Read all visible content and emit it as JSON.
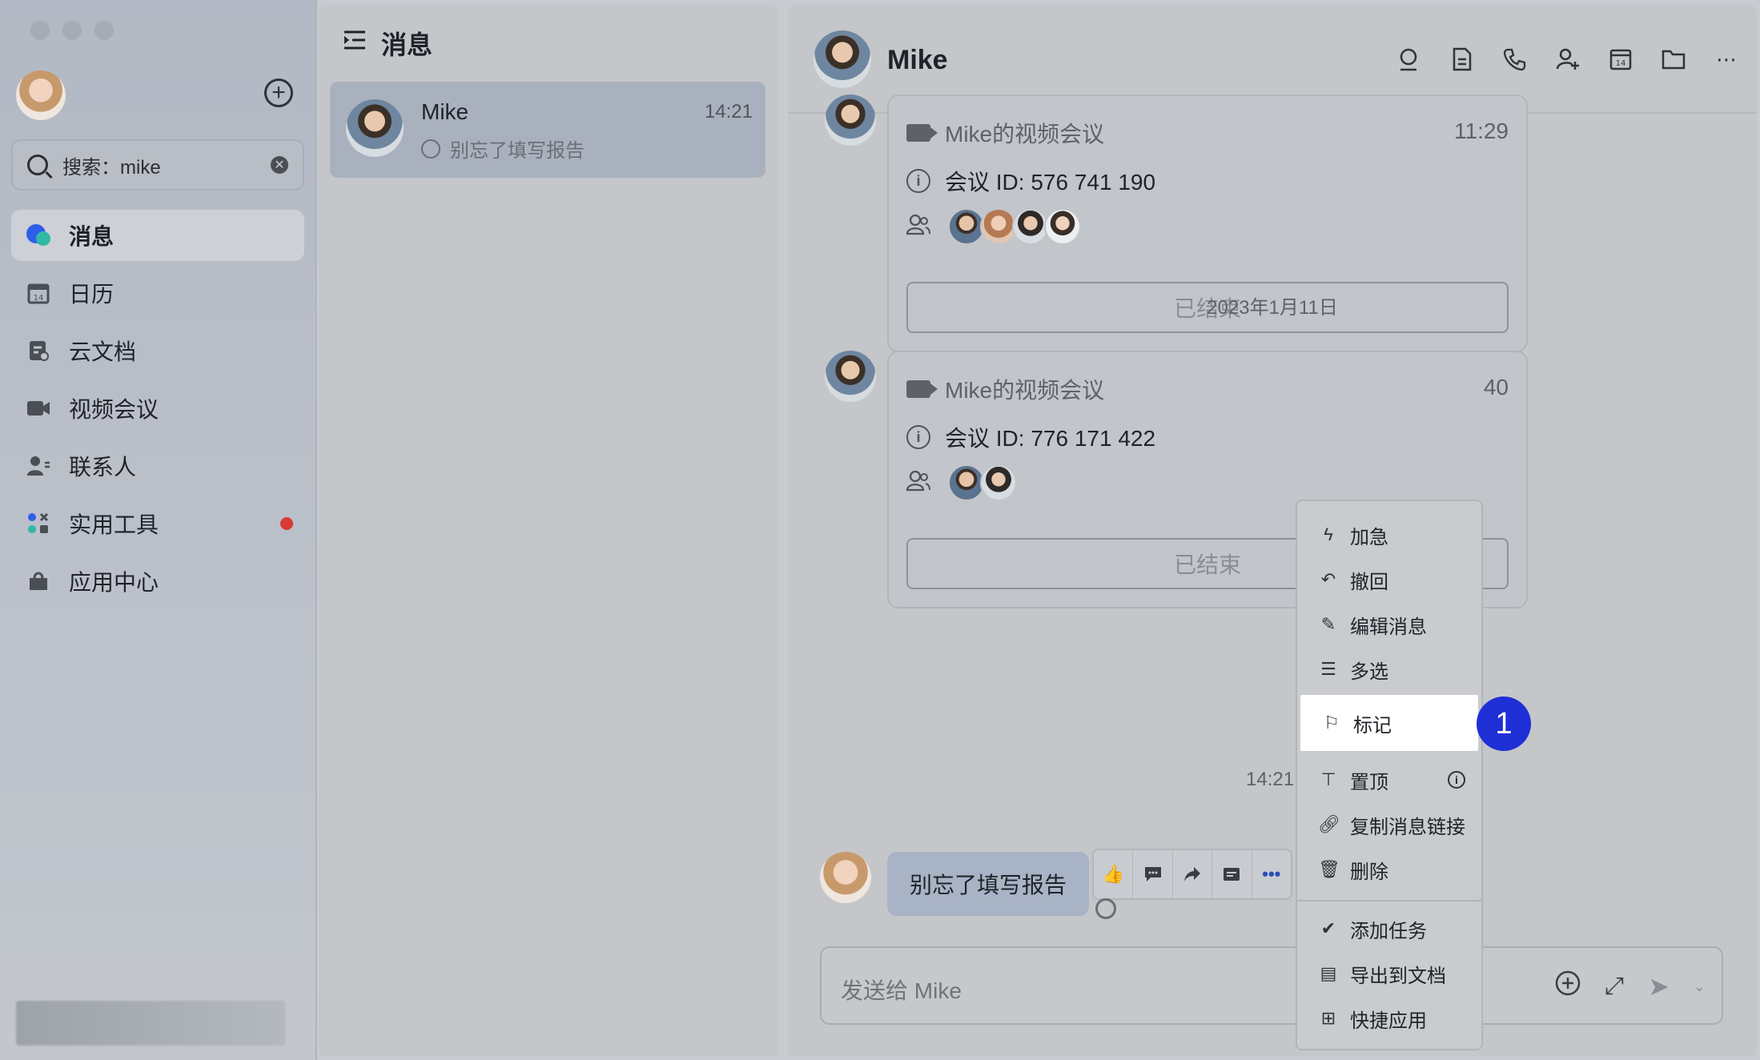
{
  "sidebar": {
    "search_text": "搜索：mike",
    "nav": [
      {
        "label": "消息",
        "icon": "message-icon",
        "active": true
      },
      {
        "label": "日历",
        "icon": "calendar-icon"
      },
      {
        "label": "云文档",
        "icon": "docs-icon"
      },
      {
        "label": "视频会议",
        "icon": "video-icon"
      },
      {
        "label": "联系人",
        "icon": "contacts-icon"
      },
      {
        "label": "实用工具",
        "icon": "tools-icon",
        "has_dot": true
      },
      {
        "label": "应用中心",
        "icon": "app-center-icon"
      }
    ],
    "accent_dot_color": "#d93a34"
  },
  "list": {
    "title": "消息",
    "conversation": {
      "name": "Mike",
      "time": "14:21",
      "preview": "别忘了填写报告"
    }
  },
  "chat": {
    "title": "Mike",
    "meetings": [
      {
        "title": "Mike的视频会议",
        "time": "11:29",
        "meeting_id": "会议 ID: 576 741 190",
        "status": "已结束"
      },
      {
        "title": "Mike的视频会议",
        "time": "40",
        "meeting_id": "会议 ID: 776 171 422",
        "status": "已结束"
      }
    ],
    "date_separator": "2023年1月11日",
    "time_label": "14:21",
    "message": "别忘了填写报告",
    "composer_placeholder": "发送给 Mike"
  },
  "menu": {
    "items": [
      "加急",
      "撤回",
      "编辑消息",
      "多选",
      "标记",
      "置顶",
      "复制消息链接",
      "删除",
      "添加任务",
      "导出到文档",
      "快捷应用"
    ],
    "highlighted": "标记"
  },
  "step_badge": "1",
  "colors": {
    "badge": "#1f2fd6",
    "bubble": "#a8b3c5"
  }
}
